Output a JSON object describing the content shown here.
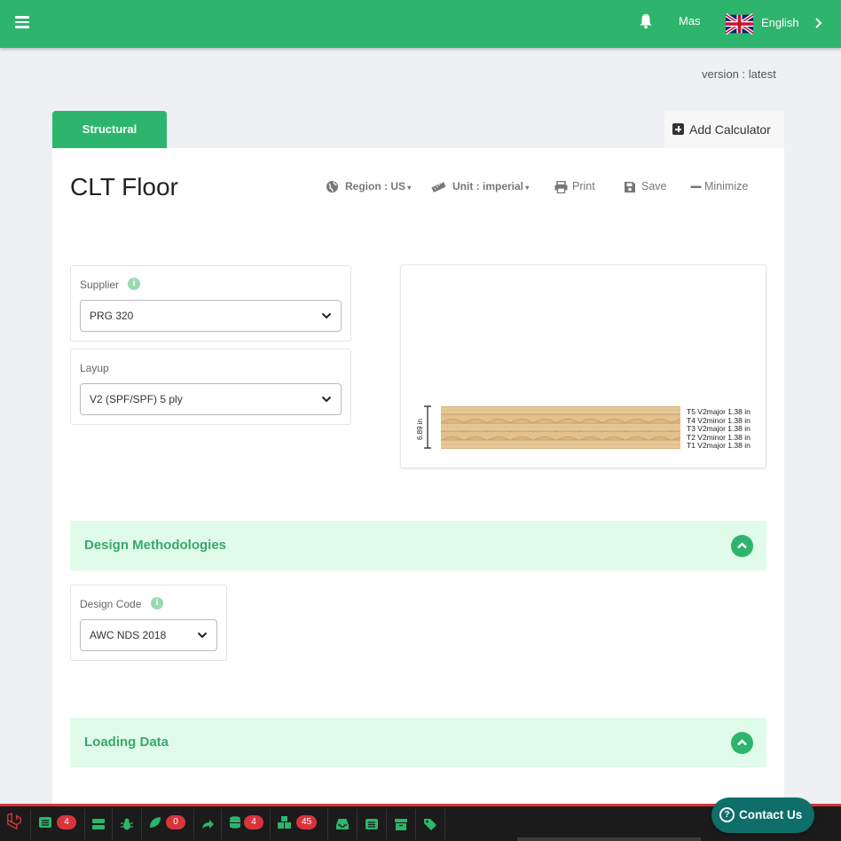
{
  "header": {
    "user_name": "Mas",
    "language": "English"
  },
  "version_text": "version : latest",
  "tabs": [
    {
      "label": "Structural",
      "active": true
    }
  ],
  "add_calculator_label": "Add Calculator",
  "calculator": {
    "title": "CLT Floor",
    "toolbar": {
      "region_label": "Region : US",
      "unit_label": "Unit : imperial",
      "print_label": "Print",
      "save_label": "Save",
      "minimize_label": "Minimize"
    },
    "supplier": {
      "label": "Supplier",
      "info": "i",
      "value": "PRG 320"
    },
    "layup": {
      "label": "Layup",
      "value": "V2 (SPF/SPF) 5 ply"
    },
    "preview": {
      "thickness_label": "6.89 in",
      "layers": [
        "T5 V2major 1.38 in",
        "T4 V2minor 1.38 in",
        "T3 V2major 1.38 in",
        "T2 V2minor 1.38 in",
        "T1 V2major 1.38 in"
      ]
    },
    "sections": {
      "design_methodologies": {
        "title": "Design Methodologies",
        "design_code": {
          "label": "Design Code",
          "info": "i",
          "value": "AWC NDS 2018"
        }
      },
      "loading_data": {
        "title": "Loading Data"
      }
    }
  },
  "debug_bar": {
    "badges": {
      "messages": "4",
      "exceptions": "0",
      "queries": "4",
      "models": "45"
    }
  },
  "contact_us": {
    "label": "Contact Us",
    "icon": "?"
  },
  "colors": {
    "brand_green": "#2db56d",
    "section_bg": "#e0fbe9",
    "contact_bg": "#0d6e6a",
    "badge_red": "#d9343b"
  }
}
